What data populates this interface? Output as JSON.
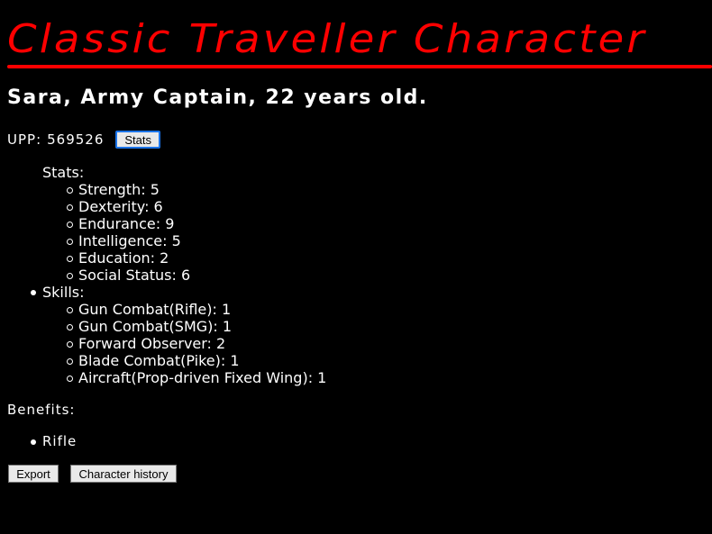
{
  "header": {
    "title": "Classic Traveller Character",
    "accent_color": "#ff0000"
  },
  "character": {
    "summary": "Sara, Army Captain, 22 years old.",
    "upp_label": "UPP:",
    "upp_value": "569526",
    "stats_button": "Stats"
  },
  "stats": {
    "label": "Stats:",
    "items": [
      "Strength: 5",
      "Dexterity: 6",
      "Endurance: 9",
      "Intelligence: 5",
      "Education: 2",
      "Social Status: 6"
    ]
  },
  "skills": {
    "label": "Skills:",
    "items": [
      "Gun Combat(Rifle): 1",
      "Gun Combat(SMG): 1",
      "Forward Observer: 2",
      "Blade Combat(Pike): 1",
      "Aircraft(Prop-driven Fixed Wing): 1"
    ]
  },
  "benefits": {
    "label": "Benefits:",
    "items": [
      "Rifle"
    ]
  },
  "actions": {
    "export_label": "Export",
    "history_label": "Character history"
  }
}
